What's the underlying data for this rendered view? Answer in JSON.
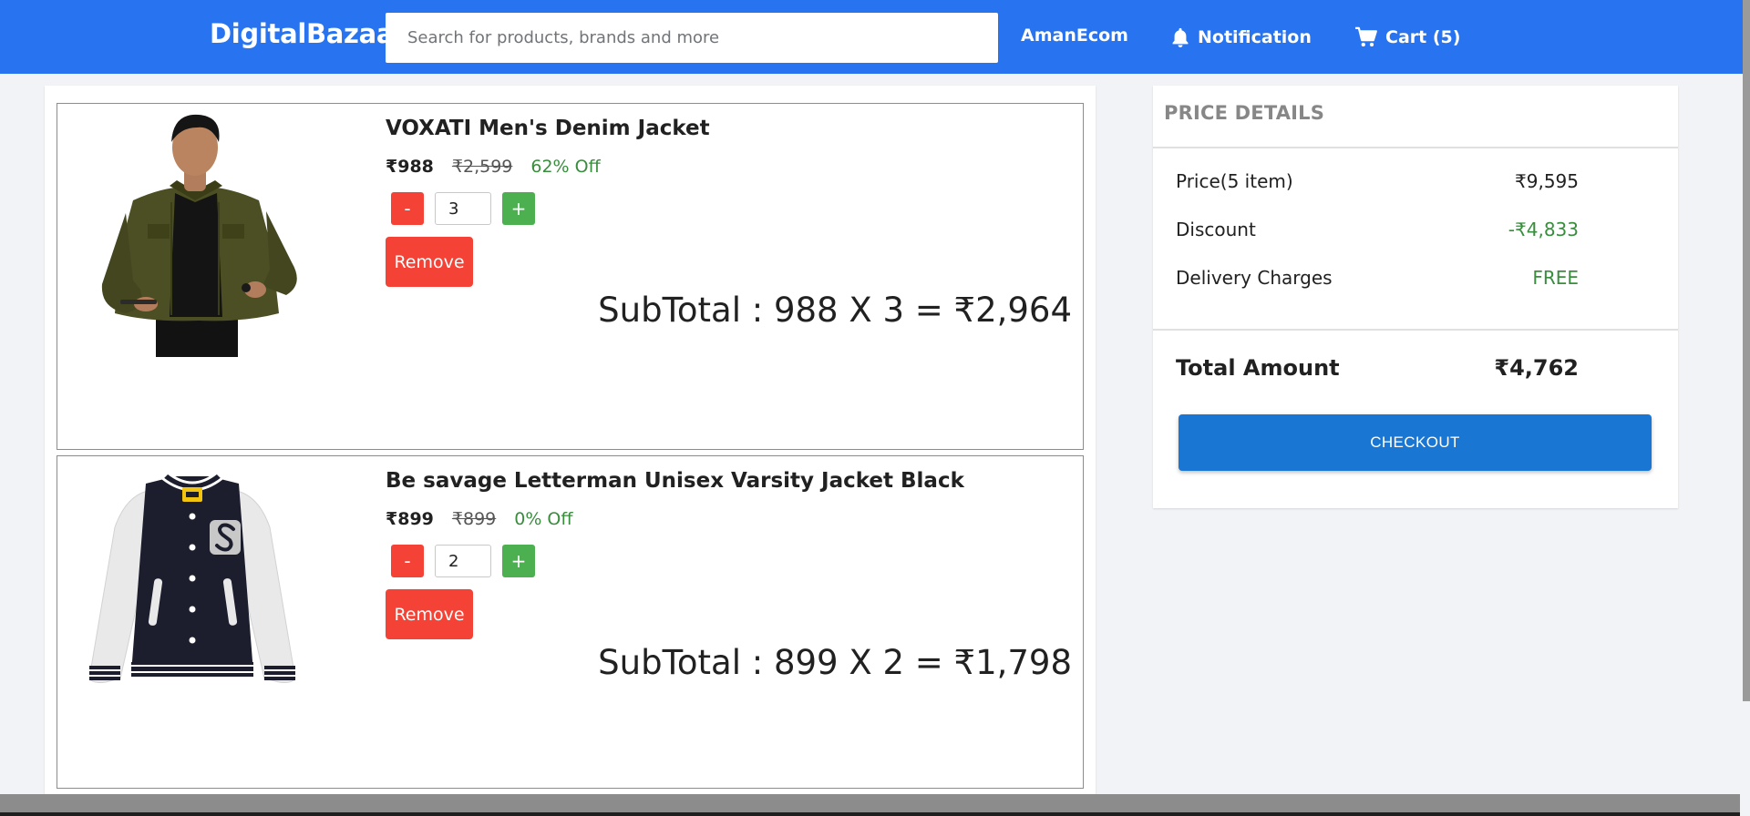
{
  "header": {
    "logo": "DigitalBazaar",
    "search_placeholder": "Search for products, brands and more",
    "user": "AmanEcom",
    "notification": "Notification",
    "cart": "Cart (5)"
  },
  "cart": {
    "items": [
      {
        "name": "VOXATI Men's Denim Jacket",
        "price": "₹988",
        "original_price": "₹2,599",
        "discount": "62% Off",
        "quantity": "3",
        "minus_label": "-",
        "plus_label": "+",
        "remove_label": "Remove",
        "subtotal": "SubTotal : 988 X 3 = ₹2,964"
      },
      {
        "name": "Be savage Letterman Unisex Varsity Jacket Black",
        "price": "₹899",
        "original_price": "₹899",
        "discount": "0% Off",
        "quantity": "2",
        "minus_label": "-",
        "plus_label": "+",
        "remove_label": "Remove",
        "subtotal": "SubTotal : 899 X 2 = ₹1,798"
      }
    ]
  },
  "price_details": {
    "title": "PRICE DETAILS",
    "price_label": "Price(5 item)",
    "price_value": "₹9,595",
    "discount_label": "Discount",
    "discount_value": "-₹4,833",
    "delivery_label": "Delivery Charges",
    "delivery_value": "FREE",
    "total_label": "Total Amount",
    "total_value": "₹4,762",
    "checkout_label": "CHECKOUT"
  },
  "colors": {
    "brand_blue": "#2874f0",
    "checkout_blue": "#1976d2",
    "danger_red": "#f44336",
    "success_green": "#4caf50",
    "discount_green": "#388e3c"
  },
  "icons": {
    "notification": "bell-icon",
    "cart": "shopping-cart-icon"
  }
}
